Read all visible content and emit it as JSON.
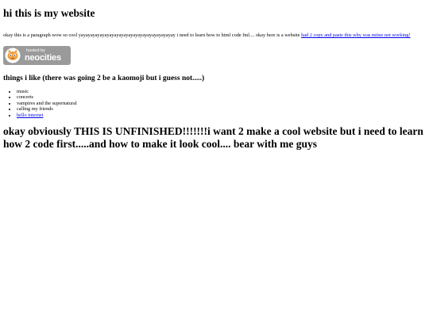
{
  "page": {
    "title": "hi this is my website",
    "intro_text": "okay this is a paragraph wow so cool yayayayayayayayayayayayayayayayayayayayay i need to learn how to html code fml.... okay here is a website ",
    "intro_link": "had 2 copy and paste this why was miine not working!"
  },
  "badge": {
    "hosted_by": "hosted by",
    "brand": "neocities",
    "icon": "neocities-cat-icon"
  },
  "likes": {
    "heading": "things i like (there was going 2 be a kaomoji but i guess not.....)",
    "items": [
      "music",
      "concerts",
      "vampires and the supernatural",
      "calling my friends"
    ],
    "link_item": "hello internet"
  },
  "footer_heading": "okay obviously THIS IS UNFINISHED!!!!!!!i want 2 make a cool website but i need to learn how 2 code first.....and how to make it look cool.... bear with me guys",
  "colors": {
    "link": "#0000ee",
    "badge_bg": "#9a9a9a",
    "cat_orange": "#f0a040"
  }
}
